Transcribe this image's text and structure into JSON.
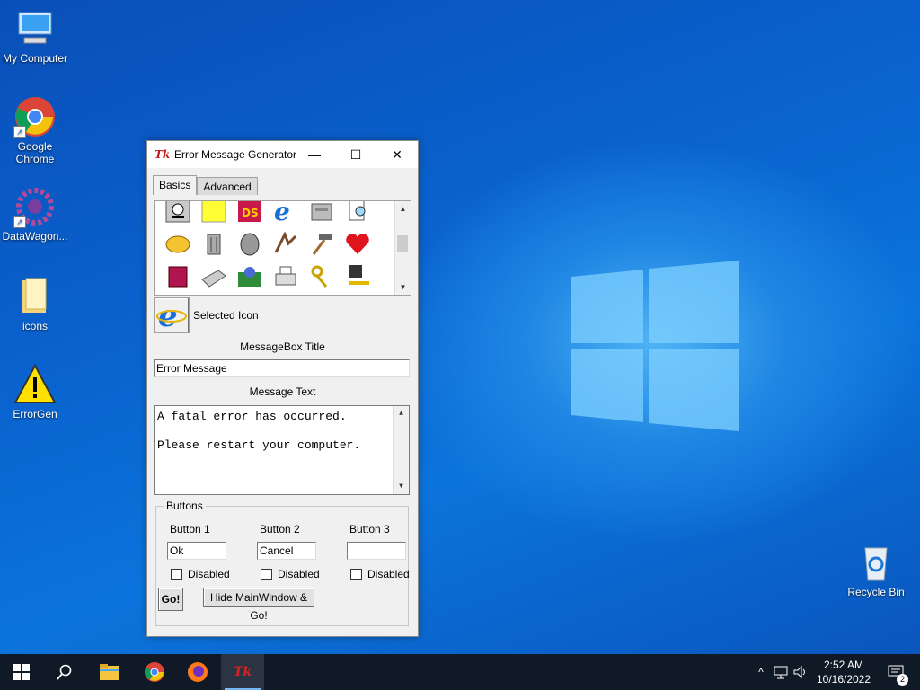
{
  "desktop": {
    "icons": [
      {
        "label": "My Computer",
        "icon": "computer-icon"
      },
      {
        "label": "Google\nChrome",
        "label1": "Google",
        "label2": "Chrome",
        "icon": "chrome-icon"
      },
      {
        "label": "DataWagon...",
        "icon": "datawagon-icon"
      },
      {
        "label": "icons",
        "icon": "folder-icon"
      },
      {
        "label": "ErrorGen",
        "icon": "warning-icon"
      },
      {
        "label": "Recycle Bin",
        "icon": "recycle-bin-icon"
      }
    ]
  },
  "window": {
    "title": "Error Message Generator",
    "tabs": [
      "Basics",
      "Advanced"
    ],
    "active_tab": "Basics",
    "selected_icon_label": "Selected Icon",
    "msgbox_title_label": "MessageBox Title",
    "msgbox_title_value": "Error Message",
    "message_text_label": "Message Text",
    "message_text_lines": [
      "A fatal error has occurred.",
      "",
      "Please restart your computer."
    ],
    "buttons_group_label": "Buttons",
    "button1_label": "Button 1",
    "button2_label": "Button 2",
    "button3_label": "Button 3",
    "button1_value": "Ok",
    "button2_value": "Cancel",
    "button3_value": "",
    "disabled_label": "Disabled",
    "go_label": "Go!",
    "hide_go_label": "Hide MainWindow & Go!"
  },
  "taskbar": {
    "time": "2:52 AM",
    "date": "10/16/2022",
    "notification_count": "2"
  },
  "colors": {
    "taskbar": "#101a26",
    "accent": "#0a63cf",
    "error_red": "#c21a1a"
  }
}
